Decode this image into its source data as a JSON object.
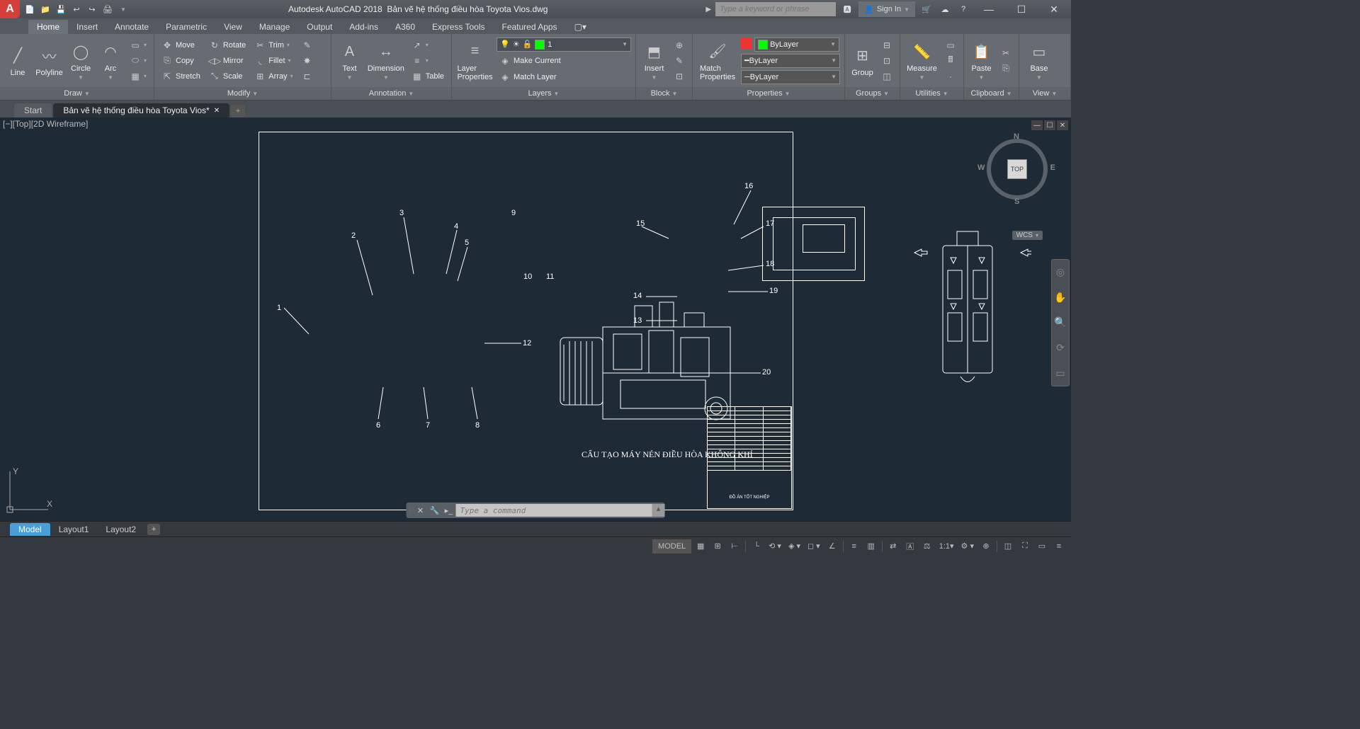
{
  "app": {
    "title_prefix": "Autodesk AutoCAD 2018",
    "title_file": "Bản vẽ hệ thống điều hòa Toyota Vios.dwg",
    "logo": "A"
  },
  "search": {
    "placeholder": "Type a keyword or phrase"
  },
  "signin": {
    "label": "Sign In"
  },
  "qat": [
    "📄",
    "📁",
    "💾",
    "↩",
    "↪",
    "🖨"
  ],
  "win": {
    "min": "—",
    "max": "☐",
    "close": "✕"
  },
  "tabs": [
    "Home",
    "Insert",
    "Annotate",
    "Parametric",
    "View",
    "Manage",
    "Output",
    "Add-ins",
    "A360",
    "Express Tools",
    "Featured Apps"
  ],
  "ribbon": {
    "draw": {
      "title": "Draw",
      "line": "Line",
      "polyline": "Polyline",
      "circle": "Circle",
      "arc": "Arc"
    },
    "modify": {
      "title": "Modify",
      "move": "Move",
      "rotate": "Rotate",
      "trim": "Trim",
      "copy": "Copy",
      "mirror": "Mirror",
      "fillet": "Fillet",
      "stretch": "Stretch",
      "scale": "Scale",
      "array": "Array"
    },
    "annotation": {
      "title": "Annotation",
      "text": "Text",
      "dimension": "Dimension",
      "table": "Table"
    },
    "layers": {
      "title": "Layers",
      "properties": "Layer\nProperties",
      "current_layer": "1",
      "make_current": "Make Current",
      "match_layer": "Match Layer"
    },
    "block": {
      "title": "Block",
      "insert": "Insert",
      "props": "Match\nProperties"
    },
    "properties": {
      "title": "Properties",
      "bylayer": "ByLayer"
    },
    "groups": {
      "title": "Groups",
      "group": "Group"
    },
    "utilities": {
      "title": "Utilities",
      "measure": "Measure"
    },
    "clipboard": {
      "title": "Clipboard",
      "paste": "Paste"
    },
    "view": {
      "title": "View",
      "base": "Base"
    }
  },
  "filetabs": {
    "start": "Start",
    "file": "Bản vẽ hệ thống điều hòa Toyota Vios*"
  },
  "viewport": {
    "control": "[−][Top][2D Wireframe]",
    "compass": {
      "n": "N",
      "s": "S",
      "e": "E",
      "w": "W",
      "top": "TOP",
      "wcs": "WCS"
    }
  },
  "drawing": {
    "title": "CẤU TẠO MÁY NÉN ĐIỀU HÒA KHÔNG KHÍ",
    "titleblock_footer": "ĐỒ ÁN TỐT NGHIỆP",
    "callouts": [
      "1",
      "2",
      "3",
      "4",
      "5",
      "6",
      "7",
      "8",
      "9",
      "10",
      "11",
      "12",
      "13",
      "14",
      "15",
      "16",
      "17",
      "18",
      "19",
      "20"
    ]
  },
  "ucs": {
    "x": "X",
    "y": "Y"
  },
  "cmd": {
    "placeholder": "Type a command"
  },
  "layout_tabs": [
    "Model",
    "Layout1",
    "Layout2"
  ],
  "status": {
    "model": "MODEL",
    "scale": "1:1"
  }
}
